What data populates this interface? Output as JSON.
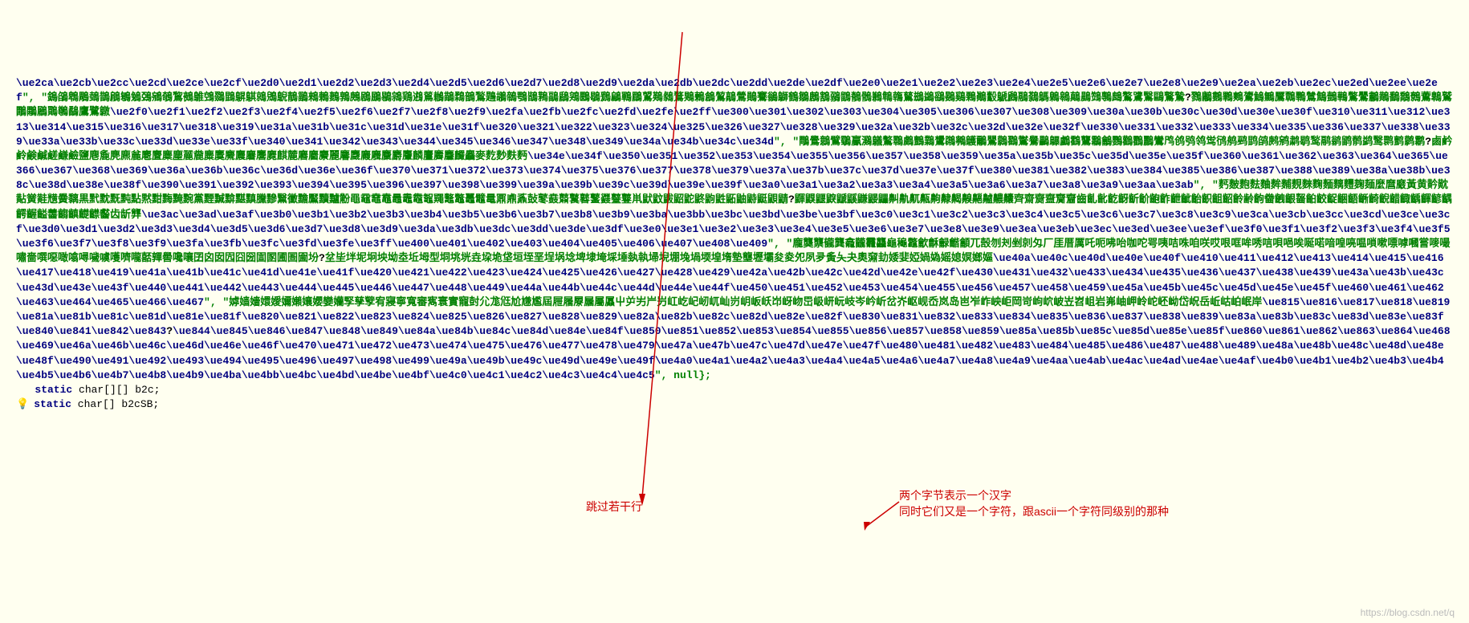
{
  "code": {
    "line1_esc": "\\ue2ca\\ue2cb\\ue2cc\\ue2cd\\ue2ce\\ue2cf\\ue2d0\\ue2d1\\ue2d2\\ue2d3\\ue2d4\\ue2d5\\ue2d6\\ue2d7\\ue2d8\\ue2d9\\ue2da\\ue2db\\ue2dc\\ue2dd\\ue2de\\ue2df\\ue2e0\\ue2e1\\ue2e2\\ue2e3\\ue2e4\\ue2e5\\ue2e6\\ue2e7\\ue2e8\\ue2e9\\ue2ea\\ue2eb\\ue2ec\\ue2ed\\ue2ee\\ue2ef",
    "line1_sep": "\", \"",
    "line1_cjk": "鵭鵮鵯鵰鵱鵲鵳鵴鵵鵶鵷鵸鵹鵺鵻鵼鵽鵾鵿鶀鶁鶂鶃鶄鶅鶆鶇鶈鶉鶊鶋鶌鶍鶎鶏鶐鶑鶒鶓鶔鶕鶖鶗鶘鶙鶚鶛鶜鶝鶞鶟鶠鶡鶢鶣鶤鶥鶦鶧鶨鶩鶪鶫鶬鶭鶮鶯鶰鶱鶲鶳鶴鶵鶶鶷鶸鶹鶺鶻鶼鶽鶾鶿鷀鷁鷂鷃鷄鷅鷆鷇鷈鷉鷊鷋鷌鷍鷎鷏鷐鷑鷒鷓鷔鷕鷖鷗鷘鷙",
    "line1_unk": "?",
    "line1_cjk2": "鷚鷛鷜鷝鷞鷟鷠鷡鷢鷣鷤鷥鷦鷧鷨鷩鷪鷫鷬鷭鷮鷯鷰鷱鷲鷳鷴鷵鷶鷷鷸鷹鷺鷻",
    "line2_esc": "\\ue2f0\\ue2f1\\ue2f2\\ue2f3\\ue2f4\\ue2f5\\ue2f6\\ue2f7\\ue2f8\\ue2f9\\ue2fa\\ue2fb\\ue2fc\\ue2fd\\ue2fe\\ue2ff\\ue300\\ue301\\ue302\\ue303\\ue304\\ue305\\ue306\\ue307\\ue308\\ue309\\ue30a\\ue30b\\ue30c\\ue30d\\ue30e\\ue30f\\ue310\\ue311\\ue312\\ue313\\ue314\\ue315\\ue316\\ue317\\ue318\\ue319\\ue31a\\ue31b\\ue31c\\ue31d\\ue31e\\ue31f\\ue320\\ue321\\ue322\\ue323\\ue324\\ue325\\ue326\\ue327\\ue328\\ue329\\ue32a\\ue32b\\ue32c\\ue32d\\ue32e\\ue32f\\ue330\\ue331\\ue332\\ue333\\ue334\\ue335\\ue336\\ue337\\ue338\\ue339\\ue33a\\ue33b\\ue33c\\ue33d\\ue33e\\ue33f\\ue340\\ue341\\ue342\\ue343\\ue344\\ue345\\ue346\\ue347\\ue348\\ue349\\ue34a\\ue34b\\ue34c\\ue34d",
    "line2_sep": "\", \"",
    "line2_cjk": "鷼鷽鷾鷿鸀鸁鸂鸃鸄鸅鸆鸇鸈鸉鸊鸋鸌鸍鸎鸏鸐鸑鸒鸓鸔鸕鸖鸗鸘鸙鸚鸛鸜鸝鸞鸤鸧鸮鸰鸴鸻鸼鹀鹍鹐鹒鹓鹔鹖鹙鹝鹟鹠鹡鹢鹥鹮鹯鹲鹴",
    "line2_unk": "?",
    "line2_cjk2": "鹵鹶鹷鹸鹹鹺鹻鹼鹽麀麁麂麃麄麅麆麇麈麉麊麋麌麍麎麏麐麑麒麓麔麕麖麗麘麙麚麛麜麝麞麟麠麡麢麣麤麥麧麨麩麪",
    "line3_esc": "\\ue34e\\ue34f\\ue350\\ue351\\ue352\\ue353\\ue354\\ue355\\ue356\\ue357\\ue358\\ue359\\ue35a\\ue35b\\ue35c\\ue35d\\ue35e\\ue35f\\ue360\\ue361\\ue362\\ue363\\ue364\\ue365\\ue366\\ue367\\ue368\\ue369\\ue36a\\ue36b\\ue36c\\ue36d\\ue36e\\ue36f\\ue370\\ue371\\ue372\\ue373\\ue374\\ue375\\ue376\\ue377\\ue378\\ue379\\ue37a\\ue37b\\ue37c\\ue37d\\ue37e\\ue37f\\ue380\\ue381\\ue382\\ue383\\ue384\\ue385\\ue386\\ue387\\ue388\\ue389\\ue38a\\ue38b\\ue38c\\ue38d\\ue38e\\ue38f\\ue390\\ue391\\ue392\\ue393\\ue394\\ue395\\ue396\\ue397\\ue398\\ue399\\ue39a\\ue39b\\ue39c\\ue39d\\ue39e\\ue39f\\ue3a0\\ue3a1\\ue3a2\\ue3a3\\ue3a4\\ue3a5\\ue3a6\\ue3a7\\ue3a8\\ue3a9\\ue3aa\\ue3ab",
    "line3_sep": "\", \"",
    "line3_cjk": "麫麬麭麮麯麰麱麲麳麴麵麶麷麹麺麼麿黀黃黄黅黆黇黉黊黋黌黐黒黓黕黖黗點黙黚黣黤黦黨黫黬黭黮黰黱黲黳黴黵黶黷黸黺黽黿鼀鼁鼂鼃鼄鼅鼆鼇鼈鼉鼊鼌鼏鼑鼒鼔鼕鼖鼘鼚鼛鼜鼝鼞鼟鼡鼣鼤鼥鼦鼧鼨鼩鼪鼫鼬鼭鼮鼰鼱",
    "line3_unk": "?",
    "line3_cjk2": "鼲鼳鼴鼵鼶鼷鼸鼹鼺鼼鼽鼿齀齁齂齃齅齆齇齈齉齊齋齌齍齎齏齒齓齔齕齖齗齘齙齚齛齜齝齞齟齠齡齢齣齤齥齦齧齨齩齪齫齬齭齮齯齰齱齲齳齴齵齶齷齸齹齺齻齼齽齾齿龂龏",
    "line4_esc": "\\ue3ac\\ue3ad\\ue3af\\ue3b0\\ue3b1\\ue3b2\\ue3b3\\ue3b4\\ue3b5\\ue3b6\\ue3b7\\ue3b8\\ue3b9\\ue3ba\\ue3bb\\ue3bc\\ue3bd\\ue3be\\ue3bf\\ue3c0\\ue3c1\\ue3c2\\ue3c3\\ue3c4\\ue3c5\\ue3c6\\ue3c7\\ue3c8\\ue3c9\\ue3ca\\ue3cb\\ue3cc\\ue3cd\\ue3ce\\ue3cf\\ue3d0\\ue3d1\\ue3d2\\ue3d3\\ue3d4\\ue3d5\\ue3d6\\ue3d7\\ue3d8\\ue3d9\\ue3da\\ue3db\\ue3dc\\ue3dd\\ue3de\\ue3df\\ue3e0\\ue3e1\\ue3e2\\ue3e3\\ue3e4\\ue3e5\\ue3e6\\ue3e7\\ue3e8\\ue3e9\\ue3ea\\ue3eb\\ue3ec\\ue3ed\\ue3ee\\ue3ef\\ue3f0\\ue3f1\\ue3f2\\ue3f3\\ue3f4\\ue3f5\\ue3f6\\ue3f7\\ue3f8\\ue3f9\\ue3fa\\ue3fb\\ue3fc\\ue3fd\\ue3fe\\ue3ff\\ue400\\ue401\\ue402\\ue403\\ue404\\ue405\\ue406\\ue407\\ue408\\ue409",
    "line4_sep": "\", \"",
    "line4_cjk": "龐龑龒龓龔龕龖龗龘龜龝龞龡龢龣龤龥兀嗀刎刔剉剠匁厂厓厝厲吒呃咈咍咖咜咢咦咭咮咱咲哎哏哐哞唀唁唄唈唉唌喏喑喤喨嗢嗩嗽嘌嘑嘓嘗嘜嘬嘯嗇噀噁噉噏噚噦噳嚄嚌嚨嚭嚲嚳嚵嚷囝囟囡囥囧圀圁圂圃圄圇坋",
    "line4_unk": "?",
    "line4_cjk2": "坌坒坢坭坰坱坳坴坵坶型垌垗垙垚垜垝垡垣垤垩埕埚埝埤埭埯埰埵埶執埽堄堋堍堝堧堭堶墊壟壢壩夋夌夗夙夛夤夨夬奧奫劸婑婓婭媧媯媱媳嫇嫏嫗",
    "line5_esc": "\\ue40a\\ue40c\\ue40d\\ue40e\\ue40f\\ue410\\ue411\\ue412\\ue413\\ue414\\ue415\\ue416\\ue417\\ue418\\ue419\\ue41a\\ue41b\\ue41c\\ue41d\\ue41e\\ue41f\\ue420\\ue421\\ue422\\ue423\\ue424\\ue425\\ue426\\ue427\\ue428\\ue429\\ue42a\\ue42b\\ue42c\\ue42d\\ue42e\\ue42f\\ue430\\ue431\\ue432\\ue433\\ue434\\ue435\\ue436\\ue437\\ue438\\ue439\\ue43a\\ue43b\\ue43c\\ue43d\\ue43e\\ue43f\\ue440\\ue441\\ue442\\ue443\\ue444\\ue445\\ue446\\ue447\\ue448\\ue449\\ue44a\\ue44b\\ue44c\\ue44d\\ue44e\\ue44f\\ue450\\ue451\\ue452\\ue453\\ue454\\ue455\\ue456\\ue457\\ue458\\ue459\\ue45a\\ue45b\\ue45c\\ue45d\\ue45e\\ue45f\\ue460\\ue461\\ue462\\ue463\\ue464\\ue465\\ue466\\ue467",
    "line5_sep": "\", \"",
    "line5_cjk": "嫭嫱嬙嬛嬡嬭嬾孃孆孌孏孯孳孼宥寢寧寬審寯寰實寵尌尣尨尩尬尲尷屆屜屩屪屫屬屭屮屰屴屵屶屸屹屺屻屼屾岃岄岅岆岇岈岉岊岋岍岏岐岑岒岓岔岕岖岘岙岚岛岜岝岞岟岠岡岢岣岤岥岦岧岨岩岪岫岬岭岮岯岰岱岲岳岴岵岶岷岸",
    "line6_esc": "\\ue815\\ue816\\ue817\\ue818\\ue819\\ue81a\\ue81b\\ue81c\\ue81d\\ue81e\\ue81f\\ue820\\ue821\\ue822\\ue823\\ue824\\ue825\\ue826\\ue827\\ue828\\ue829\\ue82a\\ue82b\\ue82c\\ue82d\\ue82e\\ue82f\\ue830\\ue831\\ue832\\ue833\\ue834\\ue835\\ue836\\ue837\\ue838\\ue839\\ue83a\\ue83b\\ue83c\\ue83d\\ue83e\\ue83f\\ue840\\ue841\\ue842\\ue843",
    "line6_unk": "?",
    "line7_esc": "\\ue844\\ue845\\ue846\\ue847\\ue848\\ue849\\ue84a\\ue84b\\ue84c\\ue84d\\ue84e\\ue84f\\ue850\\ue851\\ue852\\ue853\\ue854\\ue855\\ue856\\ue857\\ue858\\ue859\\ue85a\\ue85b\\ue85c\\ue85d\\ue85e\\ue85f\\ue860\\ue861\\ue862\\ue863\\ue864\\ue468\\ue469\\ue46a\\ue46b\\ue46c\\ue46d\\ue46e\\ue46f\\ue470\\ue471\\ue472\\ue473\\ue474\\ue475\\ue476\\ue477\\ue478\\ue479\\ue47a\\ue47b\\ue47c\\ue47d\\ue47e\\ue47f\\ue480\\ue481\\ue482\\ue483\\ue484\\ue485\\ue486\\ue487\\ue488\\ue489\\ue48a\\ue48b\\ue48c\\ue48d\\ue48e\\ue48f\\ue490\\ue491\\ue492\\ue493\\ue494\\ue495\\ue496\\ue497\\ue498\\ue499\\ue49a\\ue49b\\ue49c\\ue49d\\ue49e\\ue49f\\ue4a0\\ue4a1\\ue4a2\\ue4a3\\ue4a4\\ue4a5\\ue4a6\\ue4a7\\ue4a8\\ue4a9\\ue4aa\\ue4ab\\ue4ac\\ue4ad\\ue4ae\\ue4af\\ue4b0\\ue4b1\\ue4b2\\ue4b3\\ue4b4\\ue4b5\\ue4b6\\ue4b7\\ue4b8\\ue4b9\\ue4ba\\ue4bb\\ue4bc\\ue4bd\\ue4be\\ue4bf\\ue4c0\\ue4c1\\ue4c2\\ue4c3\\ue4c4\\ue4c5",
    "line7_tail": "\", null};",
    "static1_kw": "static",
    "static1_type": " char[][] b2c;",
    "static2_kw": "static",
    "static2_type": " char[] b2cSB;"
  },
  "annotations": {
    "skip": "跳过若干行",
    "two_byte_1": "两个字节表示一个汉字",
    "two_byte_2": "同时它们又是一个字符，跟ascii一个字符同级别的那种",
    "watermark": "https://blog.csdn.net/q"
  }
}
